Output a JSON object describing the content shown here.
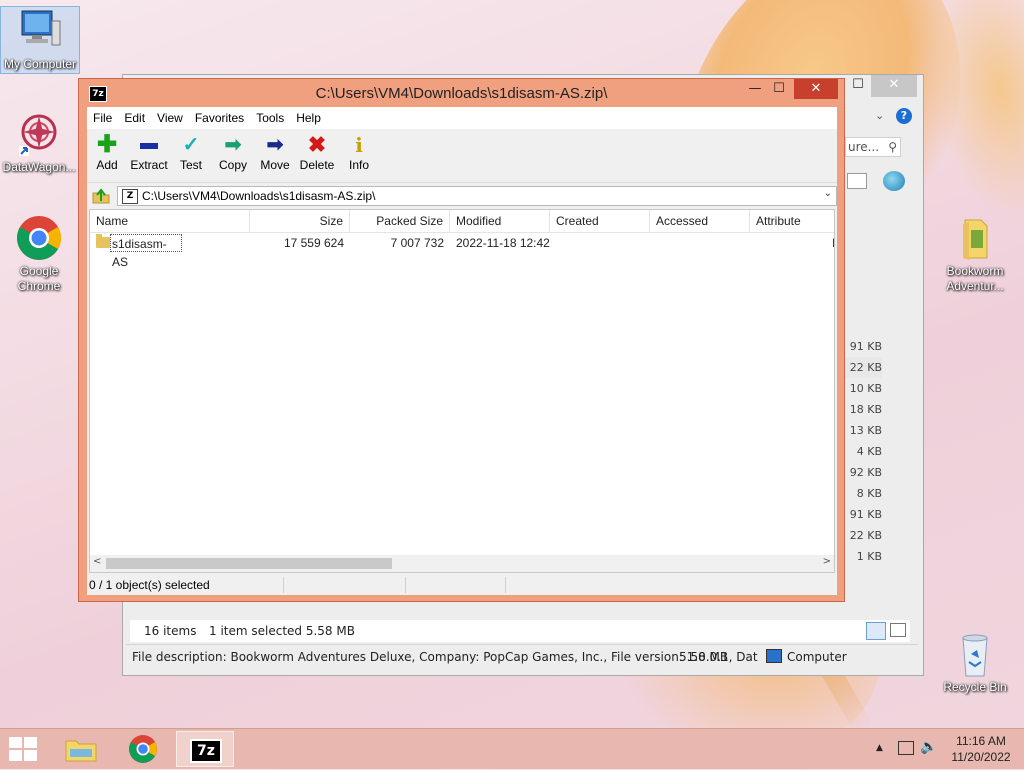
{
  "desktop": {
    "icons": [
      {
        "label": "My Computer"
      },
      {
        "label": "DataWagon..."
      },
      {
        "label": "Google Chrome"
      },
      {
        "label": "Bookworm Adventur..."
      },
      {
        "label": "Recycle Bin"
      }
    ]
  },
  "bg_window": {
    "search_placeholder": "ure...",
    "sizes": [
      "91 KB",
      "22 KB",
      "10 KB",
      "18 KB",
      "13 KB",
      "4 KB",
      "92 KB",
      "8 KB",
      "91 KB",
      "22 KB",
      "1 KB"
    ],
    "status_items": "16 items",
    "status_selected": "1 item selected  5.58 MB",
    "details": "File description: Bookworm Adventures Deluxe, Company: PopCap Games, Inc., File version: 1.0.0.1, Dat",
    "details_size": "5.58 MB",
    "location": "Computer"
  },
  "zip": {
    "title": "C:\\Users\\VM4\\Downloads\\s1disasm-AS.zip\\",
    "menu": [
      "File",
      "Edit",
      "View",
      "Favorites",
      "Tools",
      "Help"
    ],
    "toolbar": [
      {
        "label": "Add",
        "icon": "plus-icon",
        "color": "#1aa31a"
      },
      {
        "label": "Extract",
        "icon": "minus-icon",
        "color": "#1a2fa3"
      },
      {
        "label": "Test",
        "icon": "check-icon",
        "color": "#1ab0b8"
      },
      {
        "label": "Copy",
        "icon": "copy-arrow-icon",
        "color": "#18a070"
      },
      {
        "label": "Move",
        "icon": "move-arrow-icon",
        "color": "#1a2a8a"
      },
      {
        "label": "Delete",
        "icon": "x-icon",
        "color": "#d81818"
      },
      {
        "label": "Info",
        "icon": "info-icon",
        "color": "#c8a000"
      }
    ],
    "address": "C:\\Users\\VM4\\Downloads\\s1disasm-AS.zip\\",
    "columns": [
      "Name",
      "Size",
      "Packed Size",
      "Modified",
      "Created",
      "Accessed",
      "Attribute"
    ],
    "rows": [
      {
        "name": "s1disasm-AS",
        "size": "17 559 624",
        "packed": "7 007 732",
        "modified": "2022-11-18 12:42",
        "created": "",
        "accessed": "",
        "attr": "I"
      }
    ],
    "status": "0 / 1 object(s) selected"
  },
  "taskbar": {
    "time": "11:16 AM",
    "date": "11/20/2022"
  }
}
